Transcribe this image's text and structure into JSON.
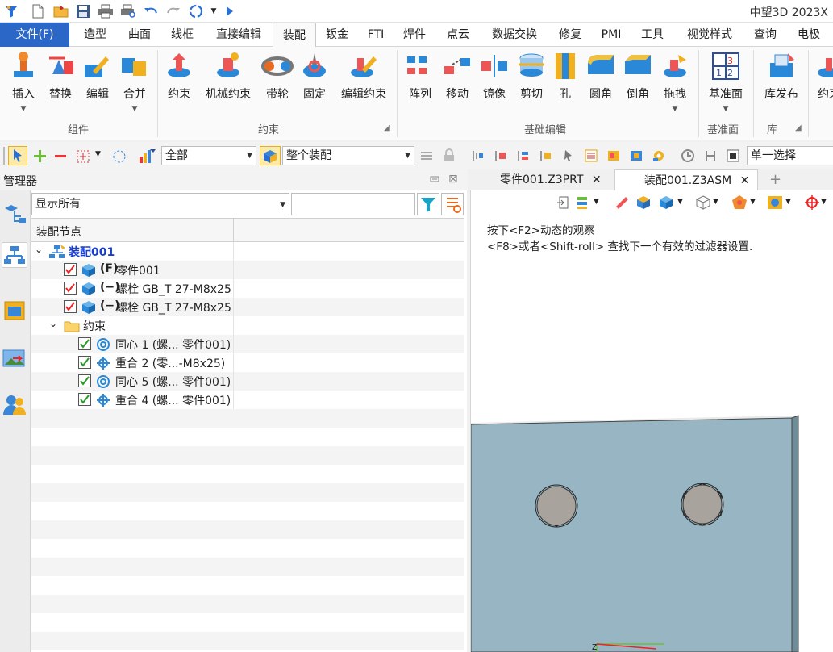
{
  "app_title": "中望3D 2023X",
  "menu": {
    "file": "文件(F)",
    "tabs": [
      "造型",
      "曲面",
      "线框",
      "直接编辑",
      "装配",
      "钣金",
      "FTI",
      "焊件",
      "点云",
      "数据交换",
      "修复",
      "PMI",
      "工具",
      "视觉样式",
      "查询",
      "电极"
    ],
    "active": "装配"
  },
  "ribbon": {
    "buttons": [
      "插入",
      "替换",
      "编辑",
      "合并",
      "约束",
      "机械约束",
      "带轮",
      "固定",
      "编辑约束",
      "阵列",
      "移动",
      "镜像",
      "剪切",
      "孔",
      "圆角",
      "倒角",
      "拖拽",
      "基准面",
      "库发布",
      "约束"
    ],
    "groups": [
      "组件",
      "约束",
      "基础编辑",
      "基准面",
      "库"
    ]
  },
  "toolbar2": {
    "filter_combo": "全部",
    "scope_combo": "整个装配",
    "select_mode": "单一选择"
  },
  "manager": {
    "title": "管理器",
    "display_combo": "显示所有",
    "column_header": "装配节点",
    "tree": {
      "root": "装配001",
      "part1_tag": "(F)",
      "part1": "零件001",
      "bolt1_tag": "(−)",
      "bolt1": "螺栓 GB_T 27-M8x25",
      "bolt2_tag": "(−)",
      "bolt2": "螺栓 GB_T 27-M8x25",
      "constraints_folder": "约束",
      "c1": "同心 1 (螺... 零件001)",
      "c2": "重合 2 (零...-M8x25)",
      "c3": "同心 5 (螺... 零件001)",
      "c4": "重合 4 (螺... 零件001)"
    }
  },
  "doc_tabs": [
    "零件001.Z3PRT",
    "装配001.Z3ASM"
  ],
  "viewport": {
    "hint1": "按下<F2>动态的观察",
    "hint2": "<F8>或者<Shift-roll> 查找下一个有效的过滤器设置."
  },
  "colors": {
    "accent": "#2b67c7",
    "plate": "#97b5c3",
    "root_text": "#1a3fd0"
  }
}
